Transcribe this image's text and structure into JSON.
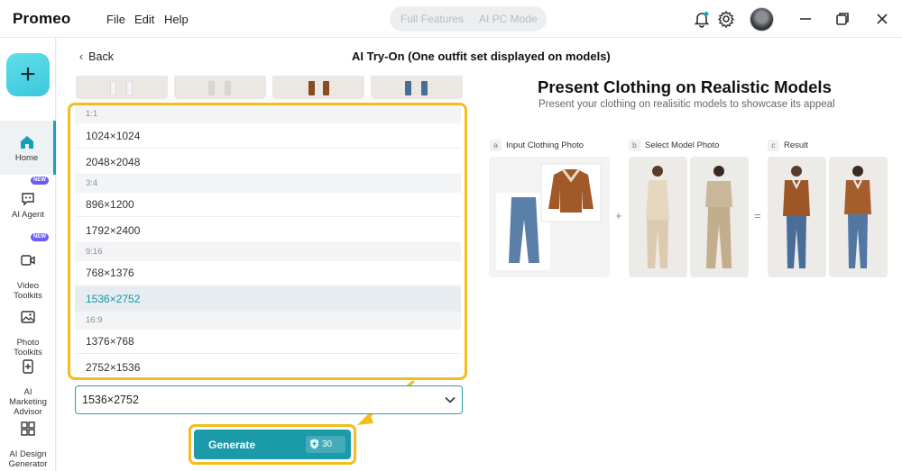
{
  "app": {
    "name": "Promeo",
    "menu": [
      "File",
      "Edit",
      "Help"
    ],
    "mode_tabs": [
      "Full Features",
      "AI PC Mode"
    ]
  },
  "sidebar": {
    "items": [
      {
        "label": "Home",
        "icon": "home-icon",
        "active": true
      },
      {
        "label": "AI Agent",
        "icon": "ai-agent-icon",
        "badge": "NEW"
      },
      {
        "label": "Video\nToolkits",
        "icon": "video-icon",
        "badge": "NEW"
      },
      {
        "label": "Photo\nToolkits",
        "icon": "photo-icon"
      },
      {
        "label": "AI\nMarketing\nAdvisor",
        "icon": "marketing-icon"
      },
      {
        "label": "AI Design\nGenerator",
        "icon": "design-grid-icon"
      }
    ]
  },
  "header": {
    "back_label": "Back",
    "title": "AI Try-On (One outfit set displayed on models)"
  },
  "dropdown": {
    "groups": [
      {
        "label": "1:1",
        "options": [
          "1024×1024",
          "2048×2048"
        ]
      },
      {
        "label": "3:4",
        "options": [
          "896×1200",
          "1792×2400"
        ]
      },
      {
        "label": "9:16",
        "options": [
          "768×1376",
          "1536×2752"
        ]
      },
      {
        "label": "16:9",
        "options": [
          "1376×768",
          "2752×1536"
        ]
      }
    ],
    "selected": "1536×2752"
  },
  "generate": {
    "label": "Generate",
    "cost": "30"
  },
  "info": {
    "title": "Present Clothing on Realistic Models",
    "subtitle": "Present your clothing on realisitic models to showcase its appeal",
    "steps": [
      {
        "letter": "a",
        "label": "Input Clothing Photo"
      },
      {
        "letter": "b",
        "label": "Select Model Photo"
      },
      {
        "letter": "c",
        "label": "Result"
      }
    ],
    "plus": "+",
    "equals": "="
  },
  "colors": {
    "accent": "#1b9aaa",
    "highlight": "#f2bd1d",
    "brand_gradient": "#4fd6e4"
  }
}
